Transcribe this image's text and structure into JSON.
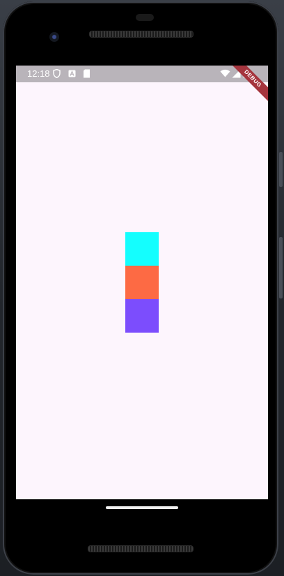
{
  "status_bar": {
    "time": "12:18",
    "icons": [
      "shield-icon",
      "a-notification-icon",
      "sd-card-icon",
      "wifi-icon",
      "signal-icon",
      "battery-icon"
    ]
  },
  "debug_banner": "DEBUG",
  "colors": {
    "background": "#fdf5fd",
    "status_bar": "#b9b4ba",
    "block_top": "#14fefe",
    "block_middle": "#fd6a44",
    "block_bottom": "#7c4dfd"
  }
}
